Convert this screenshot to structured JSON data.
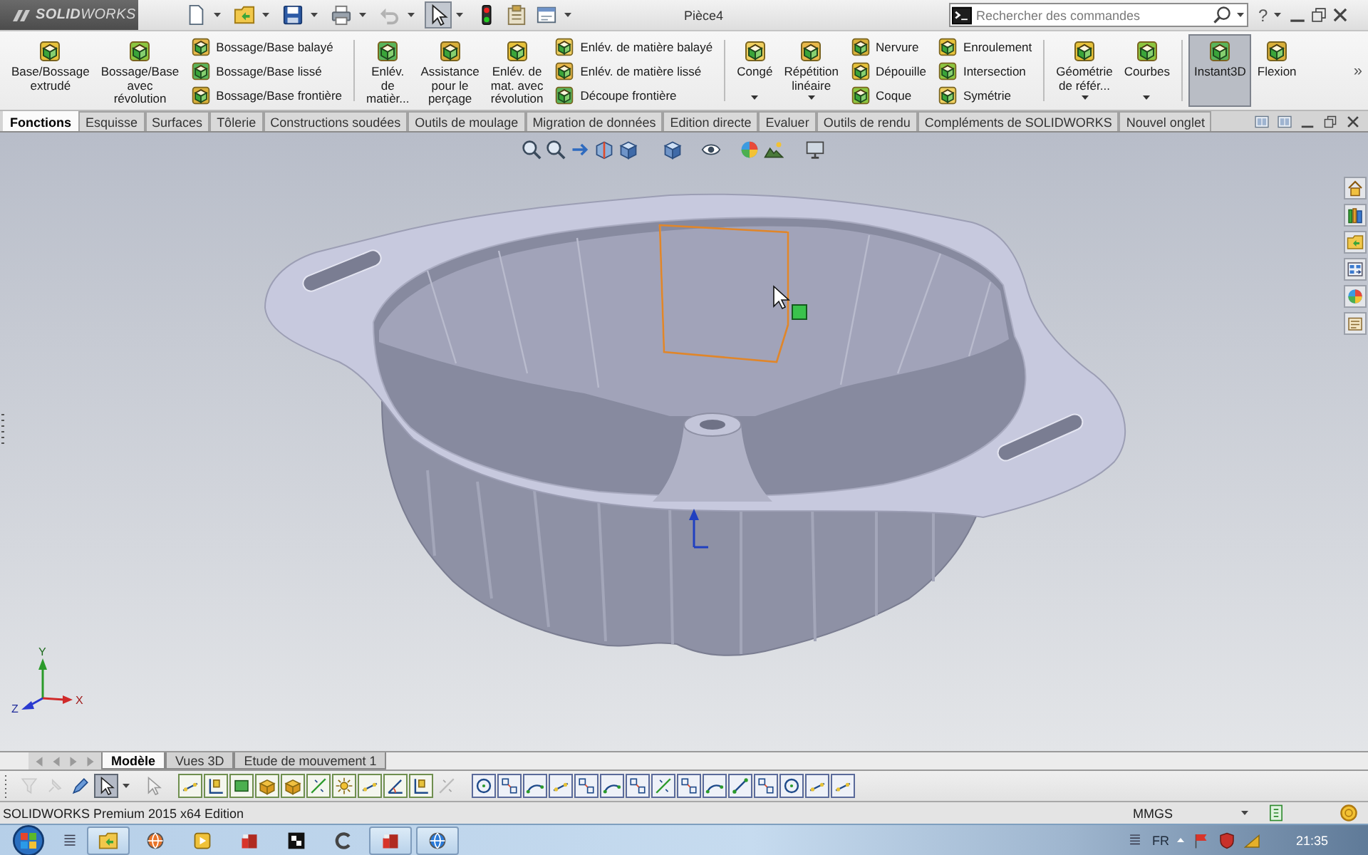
{
  "title_bar": {
    "app_name": "**SOLID**WORKS",
    "quick_access": [
      {
        "dropdown": true,
        "disabled": false,
        "pressed": false
      },
      {
        "dropdown": true,
        "disabled": false,
        "pressed": false
      },
      {
        "dropdown": true,
        "disabled": false,
        "pressed": false
      },
      {
        "dropdown": true,
        "disabled": false,
        "pressed": false
      },
      {
        "dropdown": true,
        "disabled": true,
        "pressed": false
      },
      {
        "dropdown": true,
        "disabled": false,
        "pressed": true
      },
      {
        "dropdown": false,
        "disabled": false,
        "pressed": false
      },
      {
        "dropdown": false,
        "disabled": false,
        "pressed": false
      },
      {
        "dropdown": true,
        "disabled": false,
        "pressed": false
      }
    ],
    "document_title": "Pièce4",
    "search": {
      "placeholder": "Rechercher des commandes"
    },
    "help": "?"
  },
  "ribbon": {
    "groups": [
      {
        "items": [
          {
            "kind": "large",
            "label": "Base/Bossage\nextrudé",
            "dropdown": false,
            "pressed": false
          },
          {
            "kind": "large",
            "label": "Bossage/Base\navec\nrévolution",
            "dropdown": false,
            "pressed": false
          },
          {
            "kind": "stack",
            "entries": [
              "Bossage/Base balayé",
              "Bossage/Base lissé",
              "Bossage/Base frontière"
            ]
          }
        ]
      },
      {
        "items": [
          {
            "kind": "large",
            "label": "Enlév.\nde\nmatièr...",
            "dropdown": false,
            "pressed": false
          },
          {
            "kind": "large",
            "label": "Assistance\npour le\nperçage",
            "dropdown": false,
            "pressed": false
          },
          {
            "kind": "large",
            "label": "Enlév. de\nmat. avec\nrévolution",
            "dropdown": false,
            "pressed": false
          },
          {
            "kind": "stack",
            "entries": [
              "Enlév. de matière balayé",
              "Enlév. de matière lissé",
              "Découpe frontière"
            ]
          }
        ]
      },
      {
        "items": [
          {
            "kind": "large",
            "label": "Congé",
            "dropdown": true,
            "pressed": false
          },
          {
            "kind": "large",
            "label": "Répétition\nlinéaire",
            "dropdown": true,
            "pressed": false
          },
          {
            "kind": "stack",
            "entries": [
              "Nervure",
              "Dépouille",
              "Coque"
            ]
          },
          {
            "kind": "stack",
            "entries": [
              "Enroulement",
              "Intersection",
              "Symétrie"
            ]
          }
        ]
      },
      {
        "items": [
          {
            "kind": "large",
            "label": "Géométrie\nde référ...",
            "dropdown": true,
            "pressed": false
          },
          {
            "kind": "large",
            "label": "Courbes",
            "dropdown": true,
            "pressed": false
          }
        ]
      },
      {
        "items": [
          {
            "kind": "large",
            "label": "Instant3D",
            "dropdown": false,
            "pressed": true
          },
          {
            "kind": "large",
            "label": "Flexion",
            "dropdown": false,
            "pressed": false
          }
        ]
      }
    ],
    "overflow": "»"
  },
  "command_tabs": [
    {
      "label": "Fonctions",
      "selected": true
    },
    {
      "label": "Esquisse",
      "selected": false
    },
    {
      "label": "Surfaces",
      "selected": false
    },
    {
      "label": "Tôlerie",
      "selected": false
    },
    {
      "label": "Constructions soudées",
      "selected": false
    },
    {
      "label": "Outils de moulage",
      "selected": false
    },
    {
      "label": "Migration de données",
      "selected": false
    },
    {
      "label": "Edition directe",
      "selected": false
    },
    {
      "label": "Evaluer",
      "selected": false
    },
    {
      "label": "Outils de rendu",
      "selected": false
    },
    {
      "label": "Compléments de SOLIDWORKS",
      "selected": false
    },
    {
      "label": "Nouvel onglet",
      "selected": false
    }
  ],
  "viewport": {
    "model": {
      "face_selected": true
    },
    "triad": {
      "y_label": "Y",
      "x_label": "X",
      "z_label": "Z"
    }
  },
  "model_tabs": [
    {
      "label": "Modèle",
      "selected": true
    },
    {
      "label": "Vues 3D",
      "selected": false
    },
    {
      "label": "Etude de mouvement 1",
      "selected": false
    }
  ],
  "sketch_toolbar": {
    "groups": [
      {
        "kind": "plain",
        "buttons": [
          {
            "disabled": true,
            "pressed": false,
            "dropdown": false
          },
          {
            "disabled": true,
            "pressed": false,
            "dropdown": false
          },
          {
            "disabled": false,
            "pressed": false,
            "dropdown": false
          },
          {
            "disabled": false,
            "pressed": true,
            "dropdown": true
          },
          {
            "disabled": true,
            "pressed": false,
            "dropdown": false
          }
        ]
      },
      {
        "kind": "framed",
        "buttons": [
          {
            "disabled": false,
            "pressed": false,
            "dropdown": false
          },
          {
            "disabled": false,
            "pressed": false,
            "dropdown": false
          },
          {
            "disabled": false,
            "pressed": false,
            "dropdown": false
          },
          {
            "disabled": false,
            "pressed": false,
            "dropdown": false
          },
          {
            "disabled": false,
            "pressed": false,
            "dropdown": false
          },
          {
            "disabled": false,
            "pressed": false,
            "dropdown": false
          },
          {
            "disabled": false,
            "pressed": false,
            "dropdown": false
          },
          {
            "disabled": false,
            "pressed": false,
            "dropdown": false
          },
          {
            "disabled": false,
            "pressed": false,
            "dropdown": false
          },
          {
            "disabled": false,
            "pressed": false,
            "dropdown": false
          },
          {
            "disabled": true,
            "pressed": false,
            "dropdown": false
          }
        ]
      },
      {
        "kind": "framed",
        "buttons": [
          {
            "disabled": false,
            "pressed": false,
            "dropdown": false
          },
          {
            "disabled": false,
            "pressed": false,
            "dropdown": false
          },
          {
            "disabled": false,
            "pressed": false,
            "dropdown": false
          },
          {
            "disabled": false,
            "pressed": false,
            "dropdown": false
          },
          {
            "disabled": false,
            "pressed": false,
            "dropdown": false
          },
          {
            "disabled": false,
            "pressed": false,
            "dropdown": false
          },
          {
            "disabled": false,
            "pressed": false,
            "dropdown": false
          },
          {
            "disabled": false,
            "pressed": false,
            "dropdown": false
          },
          {
            "disabled": false,
            "pressed": false,
            "dropdown": false
          },
          {
            "disabled": false,
            "pressed": false,
            "dropdown": false
          },
          {
            "disabled": false,
            "pressed": false,
            "dropdown": false
          },
          {
            "disabled": false,
            "pressed": false,
            "dropdown": false
          },
          {
            "disabled": false,
            "pressed": false,
            "dropdown": false
          },
          {
            "disabled": false,
            "pressed": false,
            "dropdown": false
          },
          {
            "disabled": false,
            "pressed": false,
            "dropdown": false
          }
        ]
      }
    ]
  },
  "status_bar": {
    "text": "SOLIDWORKS Premium 2015 x64 Edition",
    "units": "MMGS"
  },
  "taskbar": {
    "apps": [
      {
        "active": true
      },
      {
        "active": false
      },
      {
        "active": false
      },
      {
        "active": false
      },
      {
        "active": false
      },
      {
        "active": false
      },
      {
        "active": true
      },
      {
        "active": true
      }
    ],
    "language": "FR",
    "clock": "21:35"
  }
}
